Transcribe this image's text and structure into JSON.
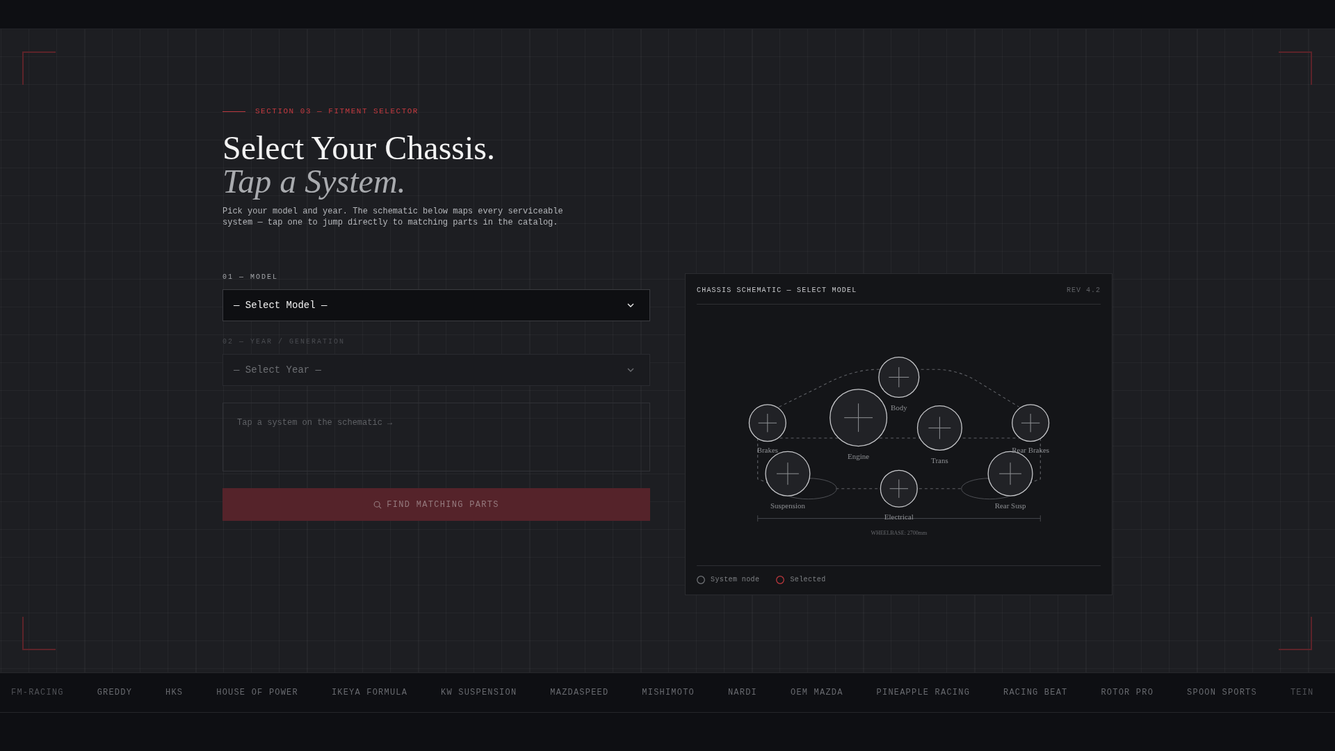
{
  "eyebrow": "SECTION 03 — FITMENT SELECTOR",
  "heading": {
    "title": "Select Your Chassis.",
    "subtitle": "Tap a System."
  },
  "intro": "Pick your model and year. The schematic below maps every serviceable system — tap one to jump directly to matching parts in the catalog.",
  "form": {
    "fields": [
      {
        "kind": "select",
        "label": "01 — MODEL",
        "placeholder": "— Select Model —",
        "disabled": false
      },
      {
        "kind": "select",
        "label": "02 — YEAR / GENERATION",
        "placeholder": "— Select Year —",
        "disabled": true
      },
      {
        "kind": "note",
        "placeholder": "Tap a system on the schematic →"
      }
    ],
    "submit": {
      "label": "FIND MATCHING PARTS",
      "disabled": true
    }
  },
  "schematic": {
    "title": "CHASSIS SCHEMATIC — SELECT MODEL",
    "revision": "REV 4.2",
    "nodes": [
      {
        "label": "Body",
        "selected": false
      },
      {
        "label": "Brakes",
        "selected": false
      },
      {
        "label": "Engine",
        "selected": false
      },
      {
        "label": "Trans",
        "selected": false
      },
      {
        "label": "Rear Brakes",
        "selected": false
      },
      {
        "label": "Suspension",
        "selected": false
      },
      {
        "label": "Electrical",
        "selected": false
      },
      {
        "label": "Rear Susp",
        "selected": false
      }
    ],
    "dimension": "WHEELBASE: 2700mm",
    "legend": [
      {
        "kind": "node",
        "label": "System node"
      },
      {
        "kind": "selected",
        "label": "Selected"
      }
    ]
  },
  "brands": [
    "FM-RACING",
    "GREDDY",
    "HKS",
    "HOUSE OF POWER",
    "IKEYA FORMULA",
    "KW SUSPENSION",
    "MAZDASPEED",
    "MISHIMOTO",
    "NARDI",
    "OEM MAZDA",
    "PINEAPPLE RACING",
    "RACING BEAT",
    "ROTOR PRO",
    "SPOON SPORTS",
    "TEIN"
  ]
}
